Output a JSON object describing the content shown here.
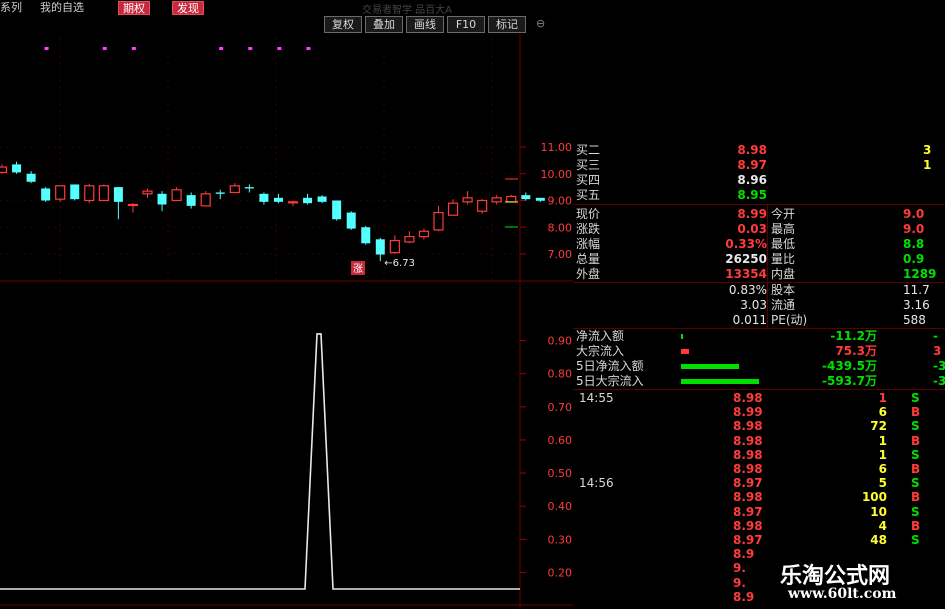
{
  "topbar": {
    "tabs": [
      {
        "label": "系列",
        "active": false
      },
      {
        "label": "我的自选",
        "active": false
      },
      {
        "label": "期权",
        "active": true
      },
      {
        "label": "发现",
        "active": true
      }
    ]
  },
  "chart_header": {
    "title": "交易者智学  品百大A"
  },
  "toolbar": {
    "buttons": [
      "复权",
      "叠加",
      "画线",
      "F10",
      "标记"
    ]
  },
  "kline": {
    "y_labels": [
      "11.00",
      "10.00",
      "9.00",
      "8.00",
      "7.00"
    ],
    "low_marker": "←6.73",
    "badge": "涨",
    "colors": {
      "up": "#ff3b3b",
      "down": "#54ffff",
      "grid": "#6a0000"
    }
  },
  "indicator": {
    "y_labels": [
      "0.90",
      "0.80",
      "0.70",
      "0.60",
      "0.50",
      "0.40",
      "0.30",
      "0.20"
    ]
  },
  "chart_data": {
    "type": "candlestick",
    "ylim": [
      6.5,
      11.6
    ],
    "candles": [
      {
        "o": 10.05,
        "c": 10.25,
        "h": 10.35,
        "l": 10.0
      },
      {
        "o": 10.35,
        "c": 10.05,
        "h": 10.45,
        "l": 10.0
      },
      {
        "o": 10.0,
        "c": 9.7,
        "h": 10.1,
        "l": 9.65
      },
      {
        "o": 9.45,
        "c": 9.0,
        "h": 9.5,
        "l": 8.95
      },
      {
        "o": 9.05,
        "c": 9.55,
        "h": 9.55,
        "l": 8.95
      },
      {
        "o": 9.6,
        "c": 9.05,
        "h": 9.6,
        "l": 9.0
      },
      {
        "o": 9.0,
        "c": 9.55,
        "h": 9.62,
        "l": 8.9
      },
      {
        "o": 9.0,
        "c": 9.55,
        "h": 9.6,
        "l": 9.0
      },
      {
        "o": 9.5,
        "c": 8.95,
        "h": 9.5,
        "l": 8.3
      },
      {
        "o": 8.85,
        "c": 8.85,
        "h": 8.9,
        "l": 8.55
      },
      {
        "o": 9.25,
        "c": 9.35,
        "h": 9.45,
        "l": 9.1
      },
      {
        "o": 9.25,
        "c": 8.85,
        "h": 9.35,
        "l": 8.6
      },
      {
        "o": 9.0,
        "c": 9.4,
        "h": 9.5,
        "l": 9.0
      },
      {
        "o": 9.2,
        "c": 8.8,
        "h": 9.3,
        "l": 8.7
      },
      {
        "o": 8.8,
        "c": 9.25,
        "h": 9.35,
        "l": 8.8
      },
      {
        "o": 9.3,
        "c": 9.25,
        "h": 9.4,
        "l": 9.05
      },
      {
        "o": 9.3,
        "c": 9.55,
        "h": 9.65,
        "l": 9.3
      },
      {
        "o": 9.5,
        "c": 9.45,
        "h": 9.6,
        "l": 9.3
      },
      {
        "o": 9.25,
        "c": 8.95,
        "h": 9.3,
        "l": 8.85
      },
      {
        "o": 9.1,
        "c": 8.95,
        "h": 9.25,
        "l": 8.9
      },
      {
        "o": 8.95,
        "c": 8.95,
        "h": 9.0,
        "l": 8.8
      },
      {
        "o": 9.1,
        "c": 8.9,
        "h": 9.25,
        "l": 8.85
      },
      {
        "o": 9.15,
        "c": 8.95,
        "h": 9.2,
        "l": 8.9
      },
      {
        "o": 9.0,
        "c": 8.3,
        "h": 9.0,
        "l": 8.25
      },
      {
        "o": 8.55,
        "c": 7.95,
        "h": 8.6,
        "l": 7.9
      },
      {
        "o": 8.0,
        "c": 7.4,
        "h": 8.05,
        "l": 7.35
      },
      {
        "o": 7.55,
        "c": 6.98,
        "h": 7.6,
        "l": 6.73
      },
      {
        "o": 7.05,
        "c": 7.5,
        "h": 7.7,
        "l": 7.0
      },
      {
        "o": 7.45,
        "c": 7.65,
        "h": 7.85,
        "l": 7.4
      },
      {
        "o": 7.65,
        "c": 7.85,
        "h": 7.95,
        "l": 7.55
      },
      {
        "o": 7.9,
        "c": 8.55,
        "h": 8.8,
        "l": 7.85
      },
      {
        "o": 8.45,
        "c": 8.9,
        "h": 9.05,
        "l": 8.45
      },
      {
        "o": 8.95,
        "c": 9.1,
        "h": 9.35,
        "l": 8.85
      },
      {
        "o": 8.6,
        "c": 9.0,
        "h": 9.05,
        "l": 8.5
      },
      {
        "o": 8.95,
        "c": 9.1,
        "h": 9.2,
        "l": 8.85
      },
      {
        "o": 8.95,
        "c": 9.15,
        "h": 9.2,
        "l": 8.95
      },
      {
        "o": 9.2,
        "c": 9.05,
        "h": 9.3,
        "l": 9.0
      },
      {
        "o": 9.1,
        "c": 8.99,
        "h": 9.1,
        "l": 8.95
      }
    ],
    "signal_marks": [
      1,
      5,
      7,
      13,
      15,
      17,
      19
    ],
    "indicator_series": {
      "ylim": [
        0.15,
        0.95
      ],
      "peak_index": 20,
      "peak_value": 0.92,
      "base_value": 0.15
    }
  },
  "panel": {
    "bids": [
      {
        "label": "买二",
        "price": "8.98",
        "color": "red",
        "vol": "3"
      },
      {
        "label": "买三",
        "price": "8.97",
        "color": "red",
        "vol": "1"
      },
      {
        "label": "买四",
        "price": "8.96",
        "color": "white",
        "vol": ""
      },
      {
        "label": "买五",
        "price": "8.95",
        "color": "green",
        "vol": ""
      }
    ],
    "quote": [
      {
        "l1": "现价",
        "v1": "8.99",
        "c1": "red",
        "l2": "今开",
        "v2": "9.0",
        "c2": "red"
      },
      {
        "l1": "涨跌",
        "v1": "0.03",
        "c1": "red",
        "l2": "最高",
        "v2": "9.0",
        "c2": "red"
      },
      {
        "l1": "涨幅",
        "v1": "0.33%",
        "c1": "red",
        "l2": "最低",
        "v2": "8.8",
        "c2": "green"
      },
      {
        "l1": "总量",
        "v1": "26250",
        "c1": "white",
        "l2": "量比",
        "v2": "0.9",
        "c2": "green"
      },
      {
        "l1": "外盘",
        "v1": "13354",
        "c1": "red",
        "l2": "内盘",
        "v2": "1289",
        "c2": "green"
      }
    ],
    "stats": [
      {
        "v1": "0.83%",
        "l2": "股本",
        "v2": "11.7"
      },
      {
        "v1": "3.03",
        "l2": "流通",
        "v2": "3.16"
      },
      {
        "v1": "0.011",
        "l2": "PE(动)",
        "v2": "588"
      }
    ],
    "flows": [
      {
        "label": "净流入额",
        "value": "-11.2万",
        "color": "green",
        "bar_color": "#00e000",
        "bar_width": 2,
        "tail": "-"
      },
      {
        "label": "大宗流入",
        "value": "75.3万",
        "color": "red",
        "bar_color": "#ff3b3b",
        "bar_width": 8,
        "tail": "3"
      },
      {
        "label": "5日净流入额",
        "value": "-439.5万",
        "color": "green",
        "bar_color": "#00e000",
        "bar_width": 58,
        "tail": "-3"
      },
      {
        "label": "5日大宗流入",
        "value": "-593.7万",
        "color": "green",
        "bar_color": "#00e000",
        "bar_width": 78,
        "tail": "-3"
      }
    ],
    "ticks": [
      {
        "time": "14:55",
        "price": "8.98",
        "vol": "1",
        "vc": "red",
        "side": "S"
      },
      {
        "time": "",
        "price": "8.99",
        "vol": "6",
        "vc": "yellow",
        "side": "B"
      },
      {
        "time": "",
        "price": "8.98",
        "vol": "72",
        "vc": "yellow",
        "side": "S"
      },
      {
        "time": "",
        "price": "8.98",
        "vol": "1",
        "vc": "yellow",
        "side": "B"
      },
      {
        "time": "",
        "price": "8.98",
        "vol": "1",
        "vc": "yellow",
        "side": "S"
      },
      {
        "time": "",
        "price": "8.98",
        "vol": "6",
        "vc": "yellow",
        "side": "B"
      },
      {
        "time": "14:56",
        "price": "8.97",
        "vol": "5",
        "vc": "yellow",
        "side": "S"
      },
      {
        "time": "",
        "price": "8.98",
        "vol": "100",
        "vc": "yellow",
        "side": "B"
      },
      {
        "time": "",
        "price": "8.97",
        "vol": "10",
        "vc": "yellow",
        "side": "S"
      },
      {
        "time": "",
        "price": "8.98",
        "vol": "4",
        "vc": "yellow",
        "side": "B"
      },
      {
        "time": "",
        "price": "8.97",
        "vol": "48",
        "vc": "yellow",
        "side": "S"
      },
      {
        "time": "",
        "price": "8.9",
        "vol": "",
        "vc": "yellow",
        "side": ""
      },
      {
        "time": "",
        "price": "9.",
        "vol": "",
        "vc": "yellow",
        "side": ""
      },
      {
        "time": "",
        "price": "9.",
        "vol": "",
        "vc": "yellow",
        "side": ""
      },
      {
        "time": "",
        "price": "8.9",
        "vol": "",
        "vc": "yellow",
        "side": ""
      }
    ]
  },
  "watermark": {
    "title": "乐淘公式网",
    "url": "www.60lt.com"
  }
}
